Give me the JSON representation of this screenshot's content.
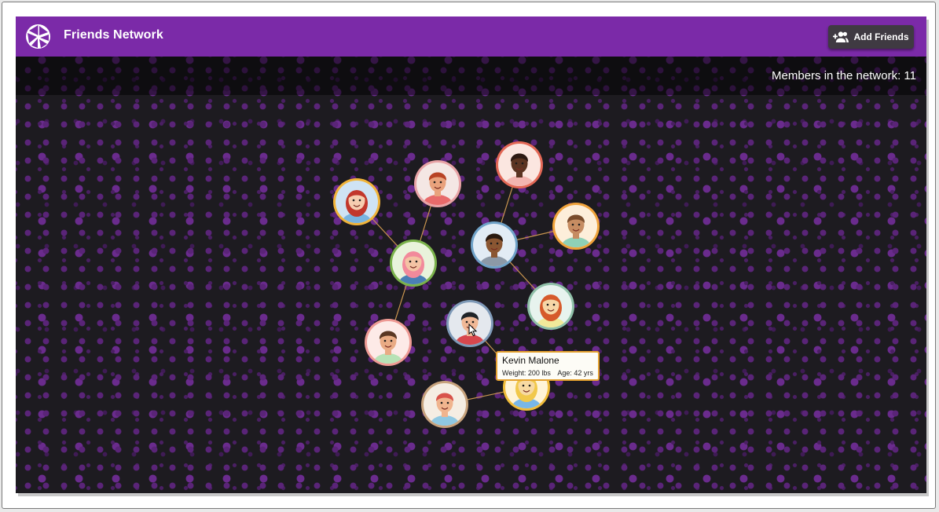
{
  "app": {
    "title": "Friends Network",
    "add_button_label": "Add Friends",
    "members_label": "Members in the network: 11",
    "colors": {
      "appbar": "#7b2aa8",
      "canvas": "#1d1b20",
      "dots": "#5a2478",
      "link": "#c9954f"
    }
  },
  "icons": {
    "logo": "geometric-logo-icon",
    "add_friends": "person-add-icon",
    "cursor": "mouse-pointer-icon"
  },
  "tooltip": {
    "name": "Kevin Malone",
    "weight": "Weight: 200 lbs",
    "age": "Age: 42 yrs"
  },
  "members": [
    {
      "id": "m1",
      "avatar": "woman-red-hair-sunglasses",
      "ring": "#f1b43a",
      "bg": "#cfe3f4",
      "skin": "#f6cdb0",
      "hair": "#c2372c",
      "shirt": "#79b4e0"
    },
    {
      "id": "m2",
      "avatar": "man-bald-red-beard",
      "ring": "#e8a3a6",
      "bg": "#f4e7e4",
      "skin": "#e9a27c",
      "hair": "#b84325",
      "shirt": "#e86a6a"
    },
    {
      "id": "m3",
      "avatar": "woman-headband",
      "ring": "#e36856",
      "bg": "#fbe6e0",
      "skin": "#5b3422",
      "hair": "#2d1a13",
      "shirt": "#f3b5b0"
    },
    {
      "id": "m4",
      "avatar": "woman-pink-curly-hair",
      "ring": "#7bb24b",
      "bg": "#e9f3db",
      "skin": "#f4c3a4",
      "hair": "#f28a9b",
      "shirt": "#4a7fb5"
    },
    {
      "id": "m5",
      "avatar": "man-dark-skin",
      "ring": "#6fa2c8",
      "bg": "#e2ecf5",
      "skin": "#8a5632",
      "hair": "#2a1a10",
      "shirt": "#8c99a7"
    },
    {
      "id": "m6",
      "avatar": "woman-tan-skin",
      "ring": "#f0a23a",
      "bg": "#fdeeda",
      "skin": "#c68c62",
      "hair": "#7a4c2c",
      "shirt": "#8fd0b6"
    },
    {
      "id": "m7",
      "avatar": "man-ginger-hair",
      "ring": "#8fc0a8",
      "bg": "#e7f3ee",
      "skin": "#f6d7a7",
      "hair": "#d65a2b",
      "shirt": "#f1ea9a"
    },
    {
      "id": "m8",
      "avatar": "man-glasses-beard",
      "ring": "#7f9ab8",
      "bg": "#e4e8ee",
      "skin": "#f0b896",
      "hair": "#1f2328",
      "shirt": "#d7474d"
    },
    {
      "id": "m9",
      "avatar": "woman-brown-curly-hair",
      "ring": "#ee9a94",
      "bg": "#fdeae7",
      "skin": "#e9ab84",
      "hair": "#5a3723",
      "shirt": "#b7e2b6"
    },
    {
      "id": "m10",
      "avatar": "man-blonde",
      "ring": "#f0bc3a",
      "bg": "#fff4d8",
      "skin": "#f7d9a2",
      "hair": "#f1c84a",
      "shirt": "#78b7e8"
    },
    {
      "id": "m11",
      "avatar": "woman-red-bob-hair",
      "ring": "#c7a27c",
      "bg": "#f5ede3",
      "skin": "#f0b48e",
      "hair": "#d8524a",
      "shirt": "#8fc8e2"
    }
  ],
  "links": [
    [
      "m1",
      "m4"
    ],
    [
      "m2",
      "m4"
    ],
    [
      "m4",
      "m9"
    ],
    [
      "m3",
      "m5"
    ],
    [
      "m5",
      "m6"
    ],
    [
      "m5",
      "m7"
    ],
    [
      "m8",
      "m10"
    ],
    [
      "m10",
      "m11"
    ]
  ]
}
